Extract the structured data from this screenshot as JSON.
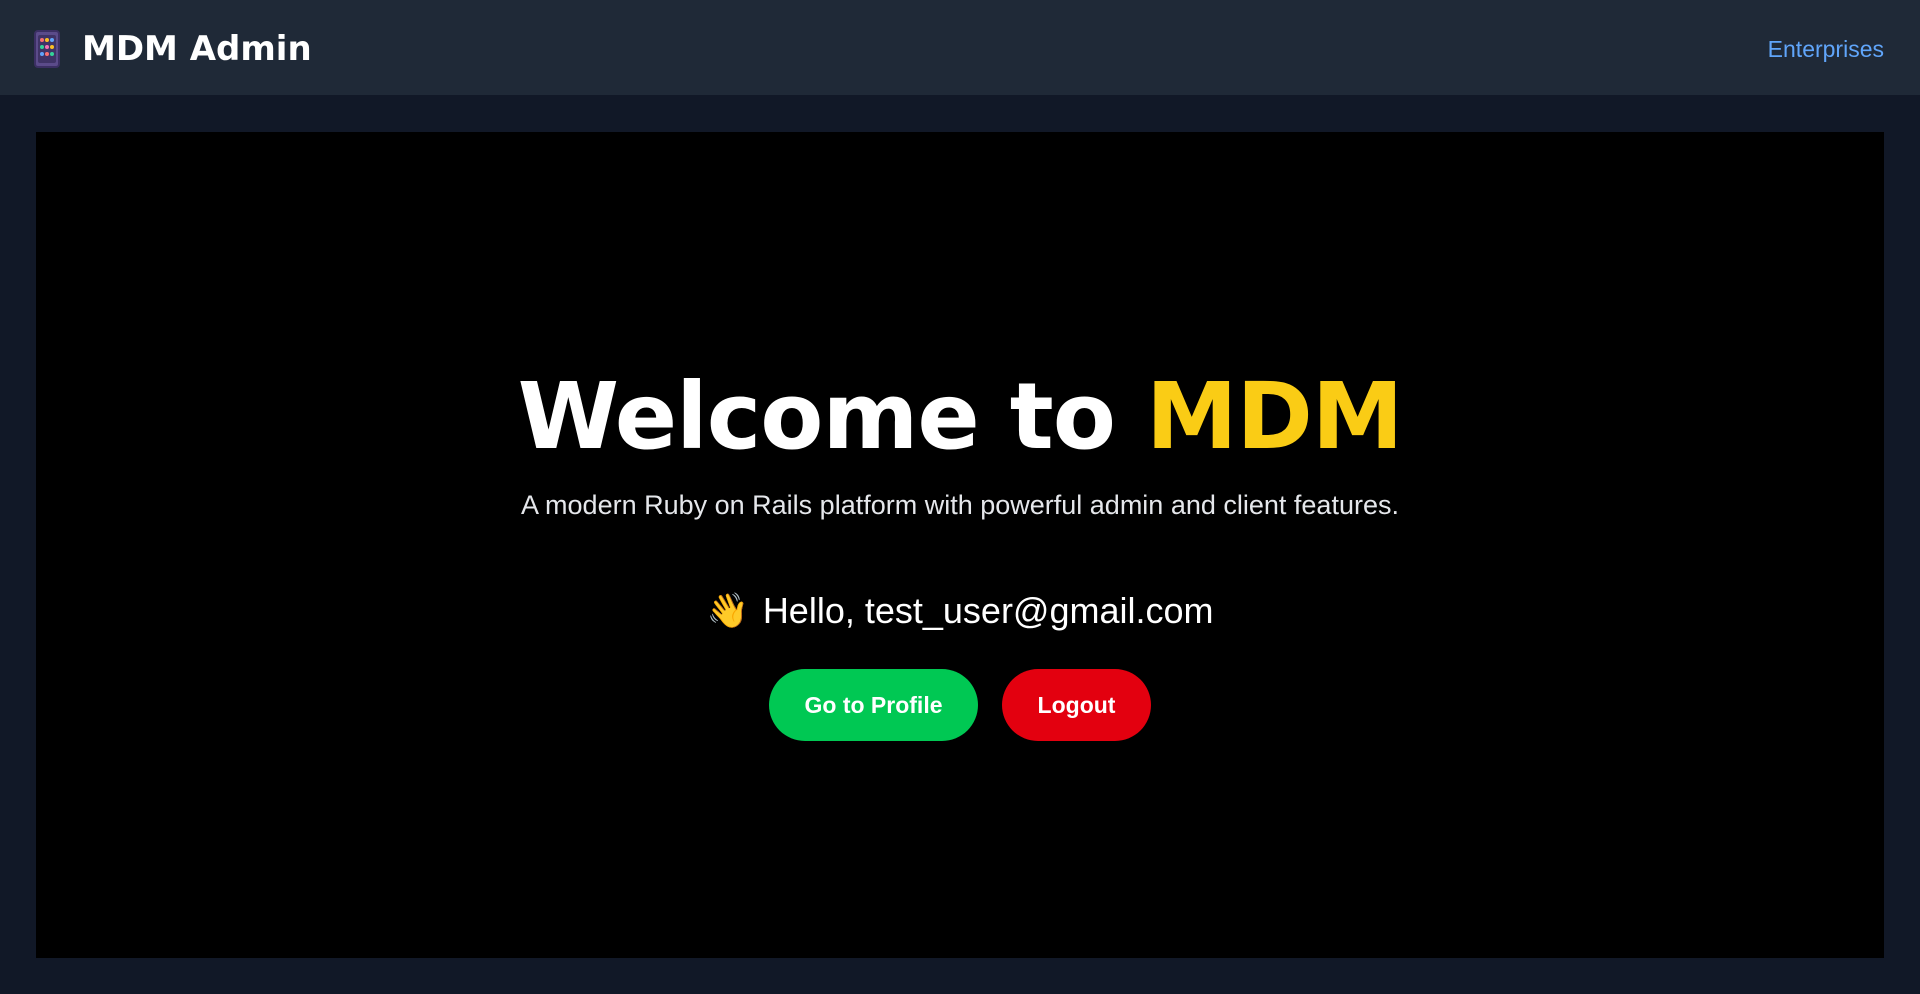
{
  "navbar": {
    "brand_icon": "abacus-icon",
    "brand_title": "MDM Admin",
    "links": [
      {
        "label": "Enterprises"
      }
    ]
  },
  "hero": {
    "title_prefix": "Welcome to ",
    "title_accent": "MDM",
    "subtitle": "A modern Ruby on Rails platform with powerful admin and client features.",
    "greeting_icon": "waving-hand-icon",
    "greeting": "Hello, test_user@gmail.com",
    "profile_button": "Go to Profile",
    "logout_button": "Logout"
  },
  "colors": {
    "page_background": "#111827",
    "navbar_background": "#1f2937",
    "hero_background": "#000000",
    "accent": "#facc15",
    "link": "#60a5fa",
    "profile_button": "#00c853",
    "logout_button": "#e3000f"
  }
}
